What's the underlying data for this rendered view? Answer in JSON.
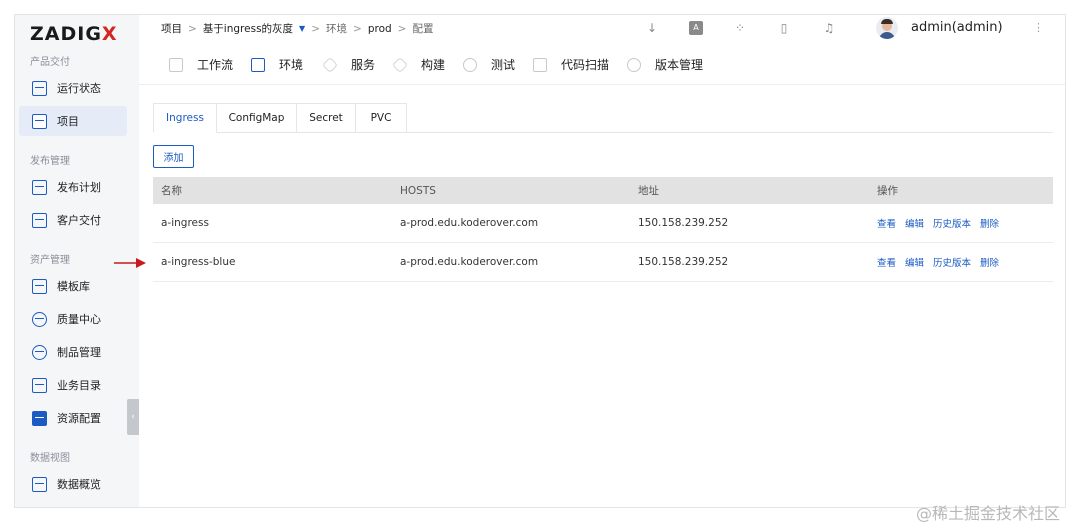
{
  "brand": {
    "logo_text_left": "ZADIG",
    "logo_text_right": "X"
  },
  "sidebar": {
    "sections": [
      {
        "title": "产品交付"
      },
      {
        "title": "发布管理"
      },
      {
        "title": "资产管理"
      },
      {
        "title": "数据视图"
      }
    ],
    "items": [
      {
        "label": "运行状态"
      },
      {
        "label": "项目"
      },
      {
        "label": "发布计划"
      },
      {
        "label": "客户交付"
      },
      {
        "label": "模板库"
      },
      {
        "label": "质量中心"
      },
      {
        "label": "制品管理"
      },
      {
        "label": "业务目录"
      },
      {
        "label": "资源配置"
      },
      {
        "label": "数据概览"
      }
    ],
    "collapse_glyph": "‹"
  },
  "breadcrumb": {
    "items": [
      "项目",
      "基于ingress的灰度",
      "环境",
      "prod",
      "配置"
    ],
    "separator": ">",
    "caret": "▼"
  },
  "header": {
    "user": "admin(admin)",
    "more": "⋮"
  },
  "nav_tabs": [
    "工作流",
    "环境",
    "服务",
    "构建",
    "测试",
    "代码扫描",
    "版本管理"
  ],
  "sub_tabs": [
    "Ingress",
    "ConfigMap",
    "Secret",
    "PVC"
  ],
  "add_button": "添加",
  "table": {
    "columns": [
      "名称",
      "HOSTS",
      "地址",
      "操作"
    ],
    "rows": [
      {
        "name": "a-ingress",
        "hosts": "a-prod.edu.koderover.com",
        "address": "150.158.239.252",
        "actions": [
          "查看",
          "编辑",
          "历史版本",
          "删除"
        ]
      },
      {
        "name": "a-ingress-blue",
        "hosts": "a-prod.edu.koderover.com",
        "address": "150.158.239.252",
        "actions": [
          "查看",
          "编辑",
          "历史版本",
          "删除"
        ]
      }
    ]
  },
  "watermark": "@稀土掘金技术社区",
  "colors": {
    "accent": "#1c5bc4",
    "brand_red": "#d2281f",
    "annotation_arrow": "#c8191f"
  }
}
